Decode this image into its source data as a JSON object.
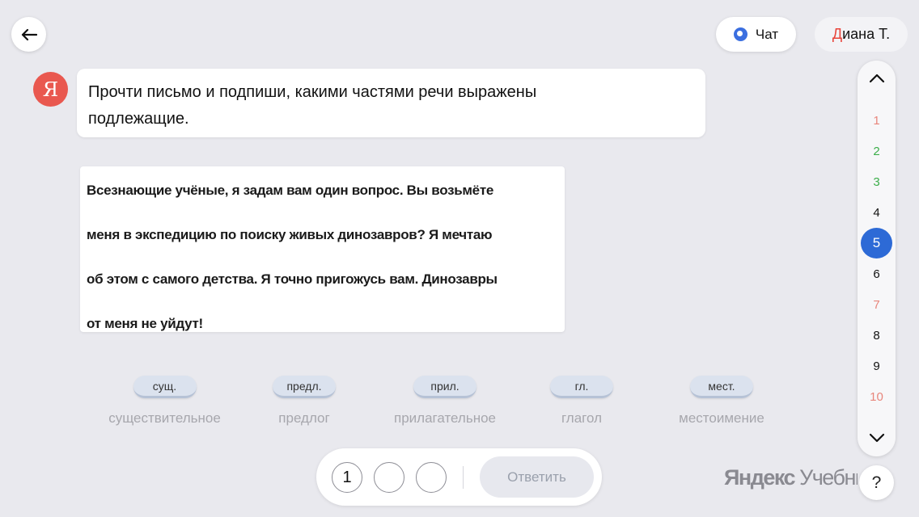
{
  "header": {
    "chat_label": "Чат",
    "user_first": "Д",
    "user_rest": "иана Т."
  },
  "assistant": {
    "avatar_letter": "Я",
    "message_line1": "Прочти письмо и подпиши, какими частями речи выражены",
    "message_line2": "подлежащие."
  },
  "letter": {
    "lines": [
      "Всезнающие учёные, я задам вам один вопрос. Вы возьмёте",
      "меня в экспедицию по поиску живых динозавров? Я мечтаю",
      "об этом с самого детства. Я точно пригожусь вам. Динозавры",
      "от меня не уйдут!"
    ]
  },
  "chips": [
    {
      "short": "сущ.",
      "full": "существительное"
    },
    {
      "short": "предл.",
      "full": "предлог"
    },
    {
      "short": "прил.",
      "full": "прилагательное"
    },
    {
      "short": "гл.",
      "full": "глагол"
    },
    {
      "short": "мест.",
      "full": "местоимение"
    }
  ],
  "answer": {
    "slot1": "1",
    "slot2": "",
    "slot3": "",
    "submit_label": "Ответить"
  },
  "questions": [
    {
      "n": "1",
      "color": "#e8867c"
    },
    {
      "n": "2",
      "color": "#3cae4a"
    },
    {
      "n": "3",
      "color": "#3cae4a"
    },
    {
      "n": "4",
      "color": "#111111"
    },
    {
      "n": "5",
      "color": "#ffffff",
      "active": true
    },
    {
      "n": "6",
      "color": "#111111"
    },
    {
      "n": "7",
      "color": "#e8867c"
    },
    {
      "n": "8",
      "color": "#111111"
    },
    {
      "n": "9",
      "color": "#111111"
    },
    {
      "n": "10",
      "color": "#e8867c"
    }
  ],
  "brand": {
    "part1": "Яндекс",
    "part2": "Учебник"
  },
  "help_label": "?",
  "colors": {
    "background": "#e9e9ee",
    "accent": "#2d6ad6",
    "avatar": "#e9584f",
    "correct": "#3cae4a",
    "wrong": "#e8867c"
  }
}
